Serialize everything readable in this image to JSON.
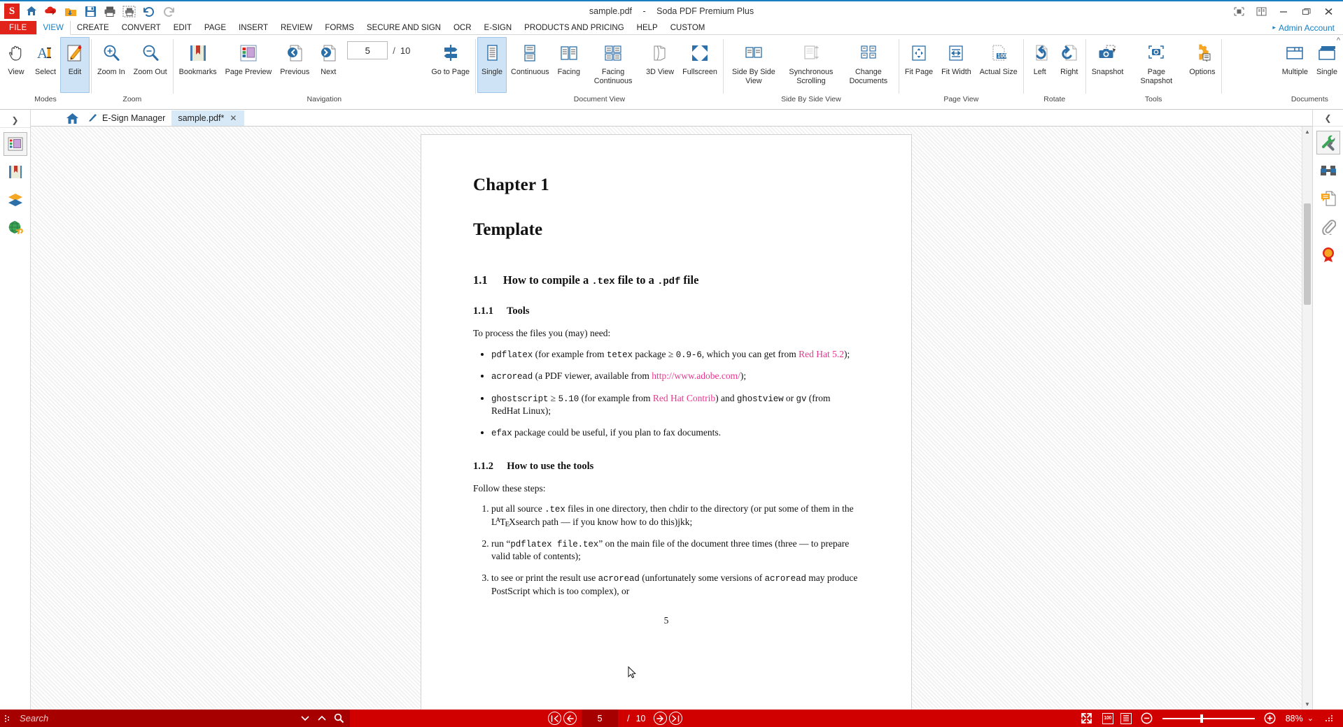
{
  "window": {
    "title_file": "sample.pdf",
    "title_dash": "-",
    "title_app": "Soda PDF Premium Plus",
    "controls": {
      "restore_view": "restore-view",
      "book_view": "book-view",
      "minimize": "minimize",
      "maximize": "maximize",
      "close": "close"
    }
  },
  "quick_access": {
    "logo": "S",
    "items": [
      {
        "name": "home-icon",
        "label": "Home"
      },
      {
        "name": "open-cloud-icon",
        "label": "Open from cloud"
      },
      {
        "name": "save-cloud-icon",
        "label": "Save to cloud"
      },
      {
        "name": "save-icon",
        "label": "Save"
      },
      {
        "name": "print-icon",
        "label": "Print"
      },
      {
        "name": "batch-print-icon",
        "label": "Batch print"
      },
      {
        "name": "undo-icon",
        "label": "Undo"
      },
      {
        "name": "redo-icon",
        "label": "Redo"
      }
    ]
  },
  "menu": {
    "file_label": "FILE",
    "tabs": [
      {
        "label": "VIEW",
        "active": true
      },
      {
        "label": "CREATE",
        "active": false
      },
      {
        "label": "CONVERT",
        "active": false
      },
      {
        "label": "EDIT",
        "active": false
      },
      {
        "label": "PAGE",
        "active": false
      },
      {
        "label": "INSERT",
        "active": false
      },
      {
        "label": "REVIEW",
        "active": false
      },
      {
        "label": "FORMS",
        "active": false
      },
      {
        "label": "SECURE AND SIGN",
        "active": false
      },
      {
        "label": "OCR",
        "active": false
      },
      {
        "label": "E-SIGN",
        "active": false
      },
      {
        "label": "PRODUCTS AND PRICING",
        "active": false
      },
      {
        "label": "HELP",
        "active": false
      },
      {
        "label": "CUSTOM",
        "active": false
      }
    ],
    "account_label": "Admin Account",
    "account_caret": "▸"
  },
  "ribbon": {
    "collapse_label": "^",
    "groups": [
      {
        "label": "Modes",
        "buttons": [
          {
            "label": "View",
            "icon": "hand-icon",
            "selected": false
          },
          {
            "label": "Select",
            "icon": "text-select-icon",
            "selected": false
          },
          {
            "label": "Edit",
            "icon": "edit-pencil-icon",
            "selected": true
          }
        ]
      },
      {
        "label": "Zoom",
        "buttons": [
          {
            "label": "Zoom In",
            "icon": "zoom-in-icon",
            "selected": false
          },
          {
            "label": "Zoom Out",
            "icon": "zoom-out-icon",
            "selected": false
          }
        ]
      },
      {
        "label": "Navigation",
        "buttons": [
          {
            "label": "Bookmarks",
            "icon": "bookmarks-icon",
            "selected": false
          },
          {
            "label": "Page Preview",
            "icon": "page-preview-icon",
            "selected": false
          },
          {
            "label": "Previous",
            "icon": "previous-page-icon",
            "selected": false
          },
          {
            "label": "Next",
            "icon": "next-page-icon",
            "selected": false
          }
        ],
        "page_field": {
          "value": "5",
          "separator": "/",
          "total": "10"
        },
        "goto": {
          "label": "Go to Page",
          "icon": "goto-page-icon"
        }
      },
      {
        "label": "Document View",
        "buttons": [
          {
            "label": "Single",
            "icon": "single-page-icon",
            "selected": true
          },
          {
            "label": "Continuous",
            "icon": "continuous-icon",
            "selected": false
          },
          {
            "label": "Facing",
            "icon": "facing-icon",
            "selected": false
          },
          {
            "label": "Facing Continuous",
            "icon": "facing-continuous-icon",
            "selected": false
          },
          {
            "label": "3D View",
            "icon": "3d-view-icon",
            "selected": false
          },
          {
            "label": "Fullscreen",
            "icon": "fullscreen-icon",
            "selected": false
          }
        ]
      },
      {
        "label": "Side By Side View",
        "buttons": [
          {
            "label": "Side By Side View",
            "icon": "side-by-side-icon",
            "selected": false
          },
          {
            "label": "Synchronous Scrolling",
            "icon": "synchronous-scrolling-icon",
            "selected": false,
            "disabled": true
          },
          {
            "label": "Change Documents",
            "icon": "change-documents-icon",
            "selected": false
          }
        ]
      },
      {
        "label": "Page View",
        "buttons": [
          {
            "label": "Fit Page",
            "icon": "fit-page-icon",
            "selected": false
          },
          {
            "label": "Fit Width",
            "icon": "fit-width-icon",
            "selected": false
          },
          {
            "label": "Actual Size",
            "icon": "actual-size-icon",
            "selected": false
          }
        ]
      },
      {
        "label": "Rotate",
        "buttons": [
          {
            "label": "Left",
            "icon": "rotate-left-icon",
            "selected": false
          },
          {
            "label": "Right",
            "icon": "rotate-right-icon",
            "selected": false
          }
        ]
      },
      {
        "label": "Tools",
        "buttons": [
          {
            "label": "Snapshot",
            "icon": "snapshot-icon",
            "selected": false
          },
          {
            "label": "Page Snapshot",
            "icon": "page-snapshot-icon",
            "selected": false
          },
          {
            "label": "Options",
            "icon": "options-gear-icon",
            "selected": false
          }
        ]
      },
      {
        "label": "Documents",
        "buttons": [
          {
            "label": "Multiple",
            "icon": "multiple-documents-icon",
            "selected": false
          },
          {
            "label": "Single",
            "icon": "single-document-icon",
            "selected": false
          }
        ]
      }
    ]
  },
  "left_rail": {
    "expand_label": "❯",
    "items": [
      {
        "name": "page-thumbnails-panel",
        "selected": true
      },
      {
        "name": "bookmarks-panel",
        "selected": false
      },
      {
        "name": "layers-panel",
        "selected": false
      },
      {
        "name": "links-panel",
        "selected": false
      }
    ]
  },
  "right_rail": {
    "collapse_label": "❮",
    "items": [
      {
        "name": "tools-wrench-panel",
        "selected": true
      },
      {
        "name": "search-binoculars-panel",
        "selected": false
      },
      {
        "name": "comments-panel",
        "selected": false
      },
      {
        "name": "attachments-panel",
        "selected": false
      },
      {
        "name": "signature-stamp-panel",
        "selected": false
      }
    ]
  },
  "document_tabs": {
    "home_icon": "home-icon",
    "tabs": [
      {
        "label": "E-Sign Manager",
        "active": false,
        "closable": false,
        "icon": "esign-pen-icon"
      },
      {
        "label": "sample.pdf*",
        "active": true,
        "closable": true,
        "close_label": "✕"
      }
    ]
  },
  "document": {
    "chapter": "Chapter 1",
    "title": "Template",
    "section_1_1_num": "1.1",
    "section_1_1_title_a": "How to compile a ",
    "section_1_1_code_a": ".tex",
    "section_1_1_title_b": " file to a ",
    "section_1_1_code_b": ".pdf",
    "section_1_1_title_c": " file",
    "section_1_1_1_num": "1.1.1",
    "section_1_1_1_title": "Tools",
    "intro_tools": "To process the files you (may) need:",
    "bullet1": {
      "code1": "pdflatex",
      "text1": " (for example from ",
      "code2": "tetex",
      "text2": " package ≥ ",
      "code3": "0.9-6",
      "text3": ", which you can get from ",
      "link": "Red Hat 5.2",
      "text4": ");"
    },
    "bullet2": {
      "code1": "acroread",
      "text1": " (a PDF viewer, available from ",
      "link": "http://www.adobe.com/",
      "text2": ");"
    },
    "bullet3": {
      "code1": "ghostscript",
      "text1": " ≥ ",
      "code2": "5.10",
      "text2": " (for example from ",
      "link": "Red Hat Contrib",
      "text3": ") and ",
      "code3": "ghostview",
      "text4": " or ",
      "code4": "gv",
      "text5": " (from RedHat Linux);"
    },
    "bullet4": {
      "code1": "efax",
      "text1": " package could be useful, if you plan to fax documents."
    },
    "section_1_1_2_num": "1.1.2",
    "section_1_1_2_title": "How to use the tools",
    "intro_steps": "Follow these steps:",
    "step1": {
      "text1": "put all source ",
      "code1": ".tex",
      "text2": " files in one directory, then chdir to the directory (or put some of them in the L",
      "latex_a": "A",
      "latex_t": "T",
      "latex_e": "E",
      "latex_x": "X",
      "text3": "search path — if you know how to do this)jkk;"
    },
    "step2": {
      "text1": "run “",
      "code1": "pdflatex file.tex",
      "text2": "” on the main file of the document three times (three — to prepare valid table of contents);"
    },
    "step3": {
      "text1": "to see or print the result use ",
      "code1": "acroread",
      "text2": " (unfortunately some versions of ",
      "code2": "acroread",
      "text3": " may produce PostScript which is too complex), or"
    },
    "folio": "5"
  },
  "status_bar": {
    "search_placeholder": "Search",
    "search_value": "",
    "search_down_icon": "chevron-down-icon",
    "search_up_icon": "chevron-up-icon",
    "search_icon": "search-magnifier-icon",
    "nav": {
      "first_label": "|◄",
      "prev_label": "◄",
      "current_page": "5",
      "separator": "/",
      "total_pages": "10",
      "next_label": "►",
      "last_label": "►|"
    },
    "view_icons": [
      {
        "name": "fullscreen-icon"
      },
      {
        "name": "actual-size-100-icon"
      },
      {
        "name": "single-page-view-icon"
      }
    ],
    "zoom": {
      "minus_label": "−",
      "plus_label": "+",
      "value": "88%",
      "caret": "⌄"
    },
    "resize_grip": "resize-grip-icon"
  },
  "colors": {
    "brand_red": "#e2231a",
    "status_red": "#d00000",
    "status_red_dark": "#a60000",
    "accent_blue": "#1a7fc1",
    "selected_tab_blue": "#cfe3f7",
    "doc_link_pink": "#e8368f"
  }
}
